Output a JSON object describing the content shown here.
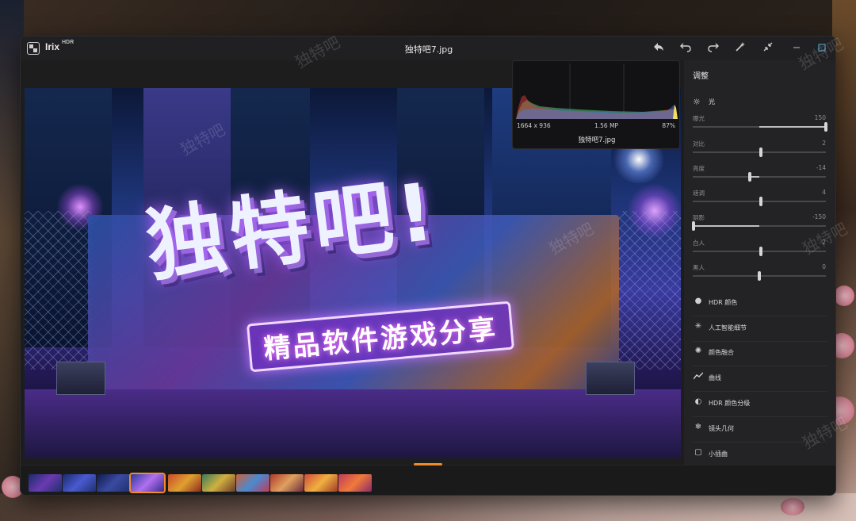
{
  "window": {
    "app_name": "Irix",
    "app_suffix": "HDR",
    "file_title": "独特吧7.jpg"
  },
  "toolbar": {
    "share_icon": "share-arrow-icon",
    "undo_icon": "undo-icon",
    "redo_icon": "redo-icon",
    "magic_icon": "magic-wand-icon",
    "collapse_icon": "collapse-icon"
  },
  "image": {
    "headline": "独特吧!",
    "subtitle": "精品软件游戏分享"
  },
  "histogram": {
    "resolution": "1664 x 936",
    "megapixels": "1.56 MP",
    "zoom": "87%",
    "filename": "独特吧7.jpg"
  },
  "panel": {
    "title": "调整",
    "section_light": "光",
    "sliders": [
      {
        "name": "曝光",
        "value": "150",
        "level": 1.0
      },
      {
        "name": "对比",
        "value": "2",
        "level": 0.51
      },
      {
        "name": "亮度",
        "value": "-14",
        "level": 0.43
      },
      {
        "name": "遮调",
        "value": "4",
        "level": 0.51
      },
      {
        "name": "阴影",
        "value": "-150",
        "level": 0.0
      },
      {
        "name": "白人",
        "value": "2",
        "level": 0.51
      },
      {
        "name": "黑人",
        "value": "0",
        "level": 0.5
      }
    ],
    "menu": [
      {
        "icon": "droplet-icon",
        "label": "HDR 颜色"
      },
      {
        "icon": "sparkle-icon",
        "label": "人工智能细节"
      },
      {
        "icon": "color-blend-icon",
        "label": "颜色融合"
      },
      {
        "icon": "curve-icon",
        "label": "曲线"
      },
      {
        "icon": "split-tone-icon",
        "label": "HDR 颜色分级"
      },
      {
        "icon": "lens-geometry-icon",
        "label": "镜头几何"
      },
      {
        "icon": "vignette-icon",
        "label": "小插曲"
      }
    ]
  },
  "watermark": "独特吧",
  "colors": {
    "accent": "#f08a2a",
    "panel_bg": "#232325",
    "window_bg": "#1d1d1e"
  }
}
